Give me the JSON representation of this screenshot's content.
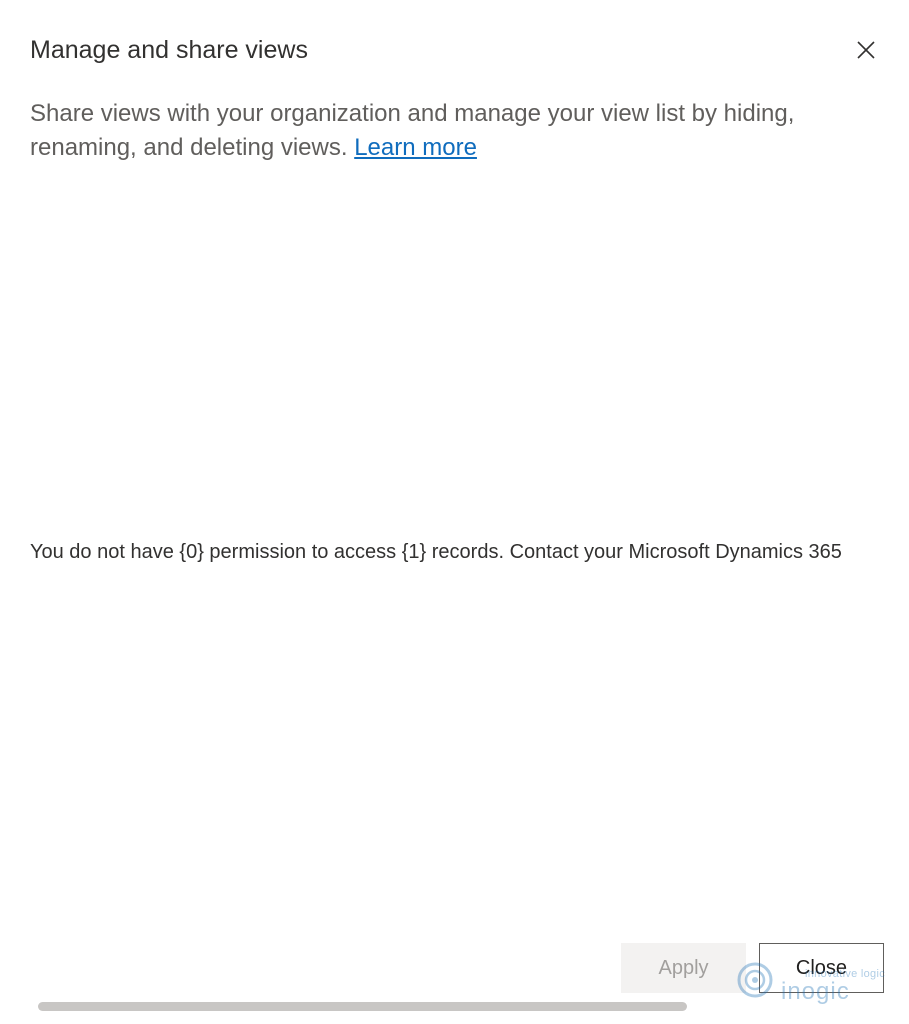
{
  "dialog": {
    "title": "Manage and share views",
    "description": "Share views with your organization and manage your view list by hiding, renaming, and deleting views.",
    "learn_more_label": "Learn more",
    "permission_message": "You do not have {0} permission to access {1} records. Contact your Microsoft Dynamics 365",
    "close_icon": "close-icon"
  },
  "footer": {
    "apply_label": "Apply",
    "close_label": "Close"
  },
  "watermark": {
    "tagline": "innovative logic",
    "brand": "inogic"
  },
  "colors": {
    "link": "#0f6cbd",
    "disabled_button_bg": "#f3f2f1",
    "disabled_button_text": "#a19f9d"
  }
}
